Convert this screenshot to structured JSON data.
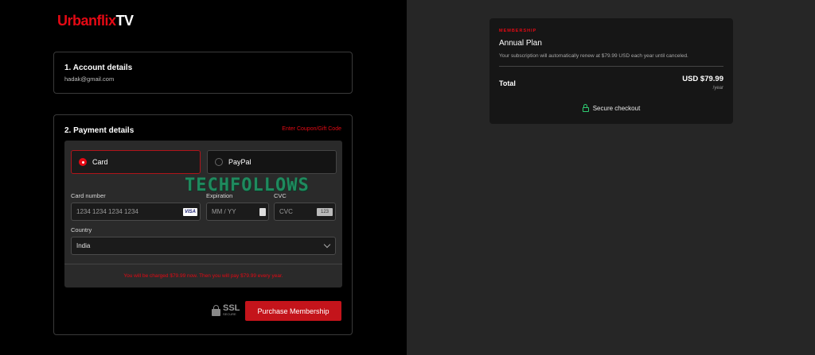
{
  "brand": {
    "name_red": "Urbanflix",
    "name_white": "TV"
  },
  "account": {
    "heading": "1. Account details",
    "email": "hadak@gmail.com"
  },
  "payment": {
    "heading": "2. Payment details",
    "coupon_link": "Enter Coupon/Gift Code",
    "methods": [
      {
        "label": "Card",
        "selected": true
      },
      {
        "label": "PayPal",
        "selected": false
      }
    ],
    "card_number": {
      "label": "Card number",
      "placeholder": "1234 1234 1234 1234",
      "icon": "visa-icon",
      "icon_text": "VISA"
    },
    "expiration": {
      "label": "Expiration",
      "placeholder": "MM / YY",
      "icon": "calendar-icon"
    },
    "cvc": {
      "label": "CVC",
      "placeholder": "CVC",
      "icon": "cvc-card-icon",
      "icon_text": "123"
    },
    "country": {
      "label": "Country",
      "value": "India"
    },
    "notice": "You will be charged $79.99 now. Then you will pay $79.99 every year.",
    "ssl_big": "SSL",
    "ssl_small": "SECURE",
    "purchase_label": "Purchase Membership"
  },
  "watermark": "TECHFOLLOWS",
  "summary": {
    "kicker": "MEMBERSHIP",
    "plan": "Annual Plan",
    "renew_text": "Your subscription will automatically renew at $79.99 USD each year until canceled.",
    "total_label": "Total",
    "price": "USD $79.99",
    "period": "/year",
    "secure_label": "Secure checkout"
  },
  "colors": {
    "accent": "#e50914",
    "secure_green": "#2ecc71",
    "left_bg": "#000000",
    "right_bg": "#262626"
  }
}
